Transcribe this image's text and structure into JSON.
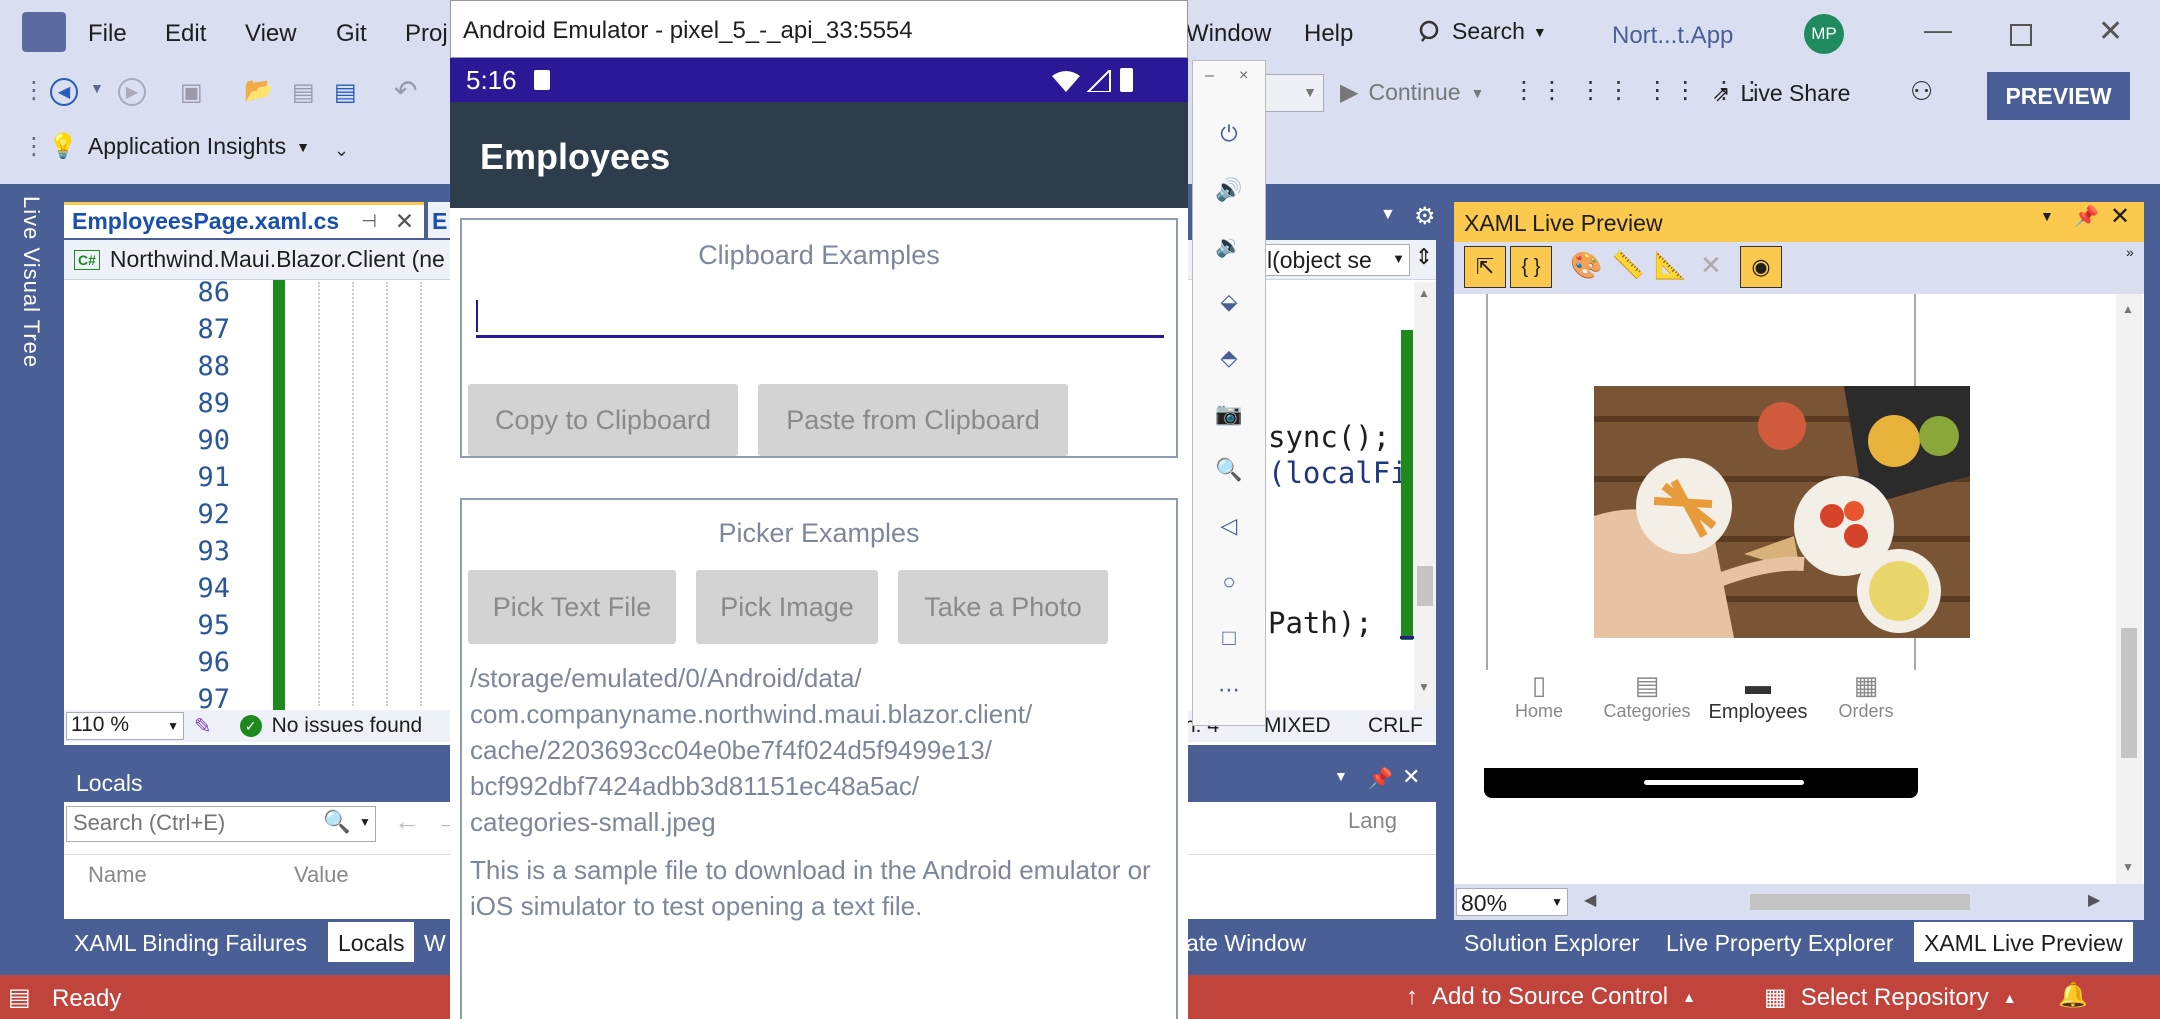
{
  "vs": {
    "menu": [
      "File",
      "Edit",
      "View",
      "Git",
      "Proj",
      "Window",
      "Help"
    ],
    "search_label": "Search",
    "solution_name": "Nort...t.App",
    "user_initials": "MP",
    "continue_label": "Continue",
    "live_share_label": "Live Share",
    "preview_label": "PREVIEW",
    "app_insights_label": "Application Insights",
    "live_visual_tree_label": "Live Visual Tree",
    "editor_tab": "EmployeesPage.xaml.cs",
    "breadcrumb_project": "Northwind.Maui.Blazor.Client (ne",
    "breadcrumb_member": "l(object se",
    "line_numbers": [
      "86",
      "87",
      "88",
      "89",
      "90",
      "91",
      "92",
      "93",
      "94",
      "95",
      "96",
      "97"
    ],
    "code_fragments": [
      "sync();",
      "(localFi",
      "Path);"
    ],
    "zoom": "110 %",
    "issues": "No issues found",
    "editor_status_right": [
      "h: 4",
      "MIXED",
      "CRLF"
    ],
    "locals_title": "Locals",
    "locals_search_placeholder": "Search (Ctrl+E)",
    "locals_columns": [
      "Name",
      "Value",
      "Lang"
    ],
    "bottom_tabs": [
      "XAML Binding Failures",
      "Locals",
      "W",
      "ate Window"
    ],
    "xaml_title": "XAML Live Preview",
    "xaml_zoom": "80%",
    "right_tabs": [
      "Solution Explorer",
      "Live Property Explorer",
      "XAML Live Preview"
    ],
    "preview_nav": [
      "Home",
      "Categories",
      "Employees",
      "Orders"
    ],
    "status_ready": "Ready",
    "status_source_control": "Add to Source Control",
    "status_repo": "Select Repository"
  },
  "emulator": {
    "window_title": "Android Emulator - pixel_5_-_api_33:5554",
    "time": "5:16",
    "app_title": "Employees",
    "clipboard_title": "Clipboard Examples",
    "copy_button": "Copy to Clipboard",
    "paste_button": "Paste from Clipboard",
    "picker_title": "Picker Examples",
    "pick_text_button": "Pick Text File",
    "pick_image_button": "Pick Image",
    "take_photo_button": "Take a Photo",
    "path_lines": [
      "/storage/emulated/0/Android/data/",
      "com.companyname.northwind.maui.blazor.client/",
      "cache/2203693cc04e0be7f4f024d5f9499e13/",
      "bcf992dbf7424adbb3d81151ec48a5ac/",
      "categories-small.jpeg"
    ],
    "file_text": "This is a sample file to download in the Android emulator or iOS simulator to test opening a text file."
  },
  "colors": {
    "accent": "#4b5d97",
    "status_bar": "#c1443c",
    "emu_status": "#2a1896",
    "appbar": "#2d3d4c",
    "tab_highlight": "#fbc94d"
  }
}
